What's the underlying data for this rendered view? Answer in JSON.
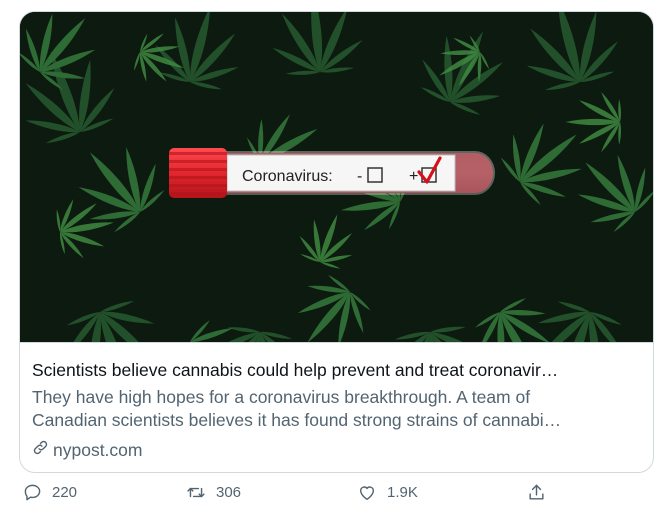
{
  "card": {
    "image": {
      "tube_label": "Coronavirus:",
      "minus_mark": "-",
      "plus_mark": "+"
    },
    "title": "Scientists believe cannabis could help prevent and treat coronavir…",
    "description_line1": "They have high hopes for a coronavirus breakthrough. A team of",
    "description_line2": "Canadian scientists believes it has found strong strains of cannabi…",
    "domain": "nypost.com"
  },
  "actions": {
    "reply_count": "220",
    "retweet_count": "306",
    "like_count": "1.9K"
  },
  "colors": {
    "tube_cap": "#e3262e",
    "tube_blood": "#8e0c16",
    "checkmark": "#d6101b",
    "icon_gray": "#536471",
    "border": "#cfd9de"
  },
  "icons": [
    "link-icon",
    "reply-icon",
    "retweet-icon",
    "like-icon",
    "share-icon"
  ]
}
